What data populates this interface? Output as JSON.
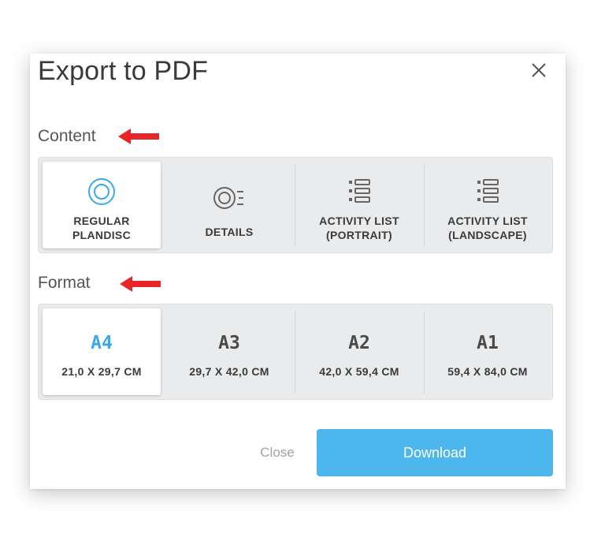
{
  "dialog": {
    "title": "Export to PDF",
    "close_icon": "close-icon"
  },
  "content_section": {
    "label": "Content",
    "arrow_color": "#e8262a",
    "options": [
      {
        "label": "REGULAR\nPLANDISC",
        "icon": "plandisc-icon",
        "selected": true
      },
      {
        "label": "DETAILS",
        "icon": "details-icon",
        "selected": false
      },
      {
        "label": "ACTIVITY LIST\n(PORTRAIT)",
        "icon": "list-icon",
        "selected": false
      },
      {
        "label": "ACTIVITY LIST\n(LANDSCAPE)",
        "icon": "list-icon",
        "selected": false
      }
    ]
  },
  "format_section": {
    "label": "Format",
    "arrow_color": "#e8262a",
    "options": [
      {
        "size": "A4",
        "dims": "21,0 X 29,7 CM",
        "selected": true
      },
      {
        "size": "A3",
        "dims": "29,7 X 42,0 CM",
        "selected": false
      },
      {
        "size": "A2",
        "dims": "42,0 X 59,4 CM",
        "selected": false
      },
      {
        "size": "A1",
        "dims": "59,4 X 84,0 CM",
        "selected": false
      }
    ]
  },
  "footer": {
    "close_label": "Close",
    "download_label": "Download"
  },
  "colors": {
    "accent": "#3aa8ec",
    "download_bg": "#4db6ec",
    "panel_bg": "#e9ebed",
    "arrow": "#e8262a"
  }
}
